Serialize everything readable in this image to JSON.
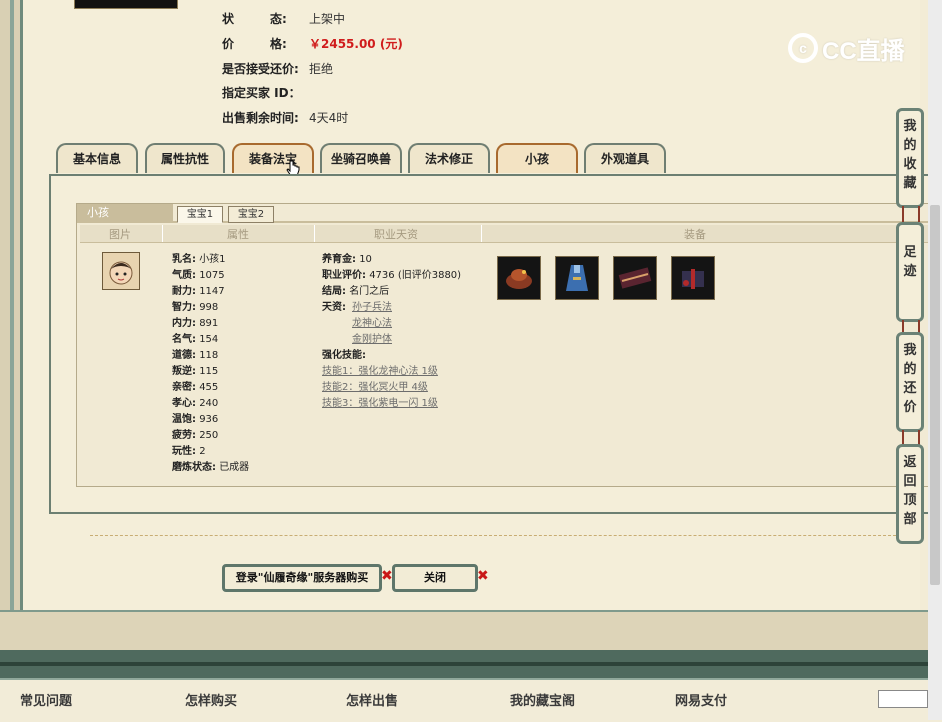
{
  "info": {
    "rows": [
      {
        "label": "状　　　态:",
        "value": "上架中"
      },
      {
        "label": "价　　　格:",
        "value": "￥2455.00 (元)"
      },
      {
        "label": "是否接受还价:",
        "value": "拒绝"
      },
      {
        "label": "指定买家 ID：",
        "value": ""
      },
      {
        "label": "出售剩余时间:",
        "value": "4天4时"
      }
    ],
    "price_color": "#d01c1c"
  },
  "watermark": {
    "text": "CC直播"
  },
  "tabs": [
    "基本信息",
    "属性抗性",
    "装备法宝",
    "坐骑召唤兽",
    "法术修正",
    "小孩",
    "外观道具"
  ],
  "kid_panel": {
    "header": "小孩",
    "subtabs": [
      "宝宝1",
      "宝宝2"
    ],
    "columns": [
      "图片",
      "属性",
      "职业天资",
      "装备"
    ],
    "attributes": [
      {
        "k": "乳名:",
        "v": "小孩1"
      },
      {
        "k": "气质:",
        "v": "1075"
      },
      {
        "k": "耐力:",
        "v": "1147"
      },
      {
        "k": "智力:",
        "v": "998"
      },
      {
        "k": "内力:",
        "v": "891"
      },
      {
        "k": "名气:",
        "v": "154"
      },
      {
        "k": "道德:",
        "v": "118"
      },
      {
        "k": "叛逆:",
        "v": "115"
      },
      {
        "k": "亲密:",
        "v": "455"
      },
      {
        "k": "孝心:",
        "v": "240"
      },
      {
        "k": "温饱:",
        "v": "936"
      },
      {
        "k": "疲劳:",
        "v": "250"
      },
      {
        "k": "玩性:",
        "v": "2"
      },
      {
        "k": "磨炼状态:",
        "v": "已成器"
      }
    ],
    "career": {
      "raise_gold": {
        "k": "养育金:",
        "v": "10"
      },
      "rating": {
        "k": "职业评价:",
        "v": "4736 (旧评价3880)"
      },
      "ending": {
        "k": "结局:",
        "v": "名门之后"
      },
      "talent_label": "天资:",
      "talents": [
        "孙子兵法",
        "龙神心法",
        "金刚护体"
      ],
      "skills_label": "强化技能:",
      "skills": [
        "技能1：强化龙神心法 1级",
        "技能2：强化冥火甲 4级",
        "技能3：强化紫电一闪 1级"
      ]
    },
    "equipment_icons": [
      "hat-icon",
      "robe-icon",
      "weapon-box-icon",
      "gift-box-icon"
    ]
  },
  "buttons": {
    "buy": "登录\"仙履奇缘\"服务器购买",
    "close": "关闭"
  },
  "side_buttons": [
    "我的收藏",
    "足迹",
    "我的还价",
    "返回顶部"
  ],
  "footer_nav": [
    "常见问题",
    "怎样购买",
    "怎样出售",
    "我的藏宝阁",
    "网易支付"
  ]
}
